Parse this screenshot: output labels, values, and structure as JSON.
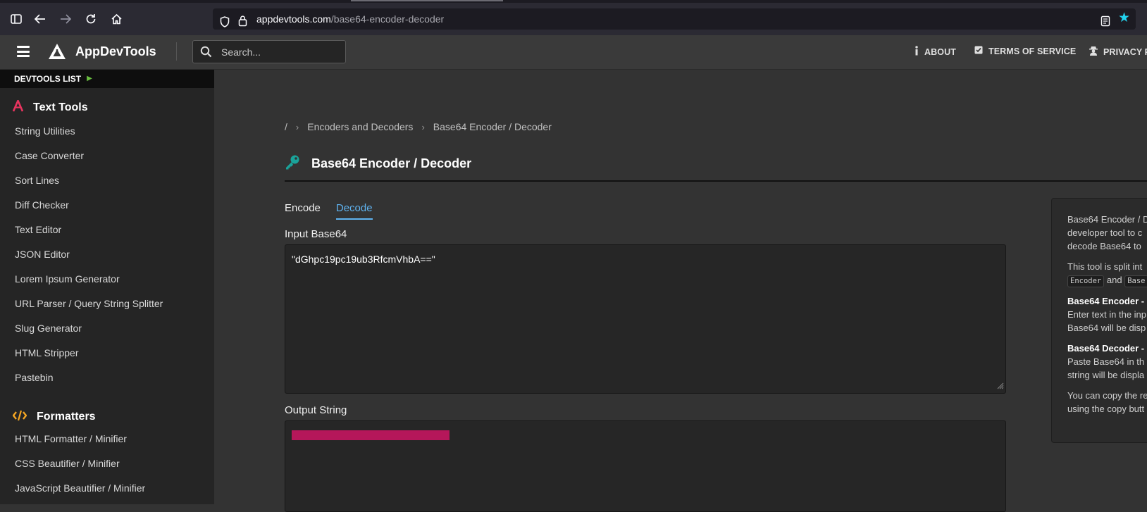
{
  "browser": {
    "url_host": "appdevtools.com",
    "url_path": "/base64-encoder-decoder"
  },
  "header": {
    "brand": "AppDevTools",
    "search_placeholder": "Search...",
    "links": {
      "about": "ABOUT",
      "terms": "TERMS OF SERVICE",
      "privacy": "PRIVACY P"
    }
  },
  "sidebar": {
    "list_label": "DEVTOOLS LIST",
    "sections": [
      {
        "title": "Text Tools",
        "icon": "text-a-icon",
        "items": [
          "String Utilities",
          "Case Converter",
          "Sort Lines",
          "Diff Checker",
          "Text Editor",
          "JSON Editor",
          "Lorem Ipsum Generator",
          "URL Parser / Query String Splitter",
          "Slug Generator",
          "HTML Stripper",
          "Pastebin"
        ]
      },
      {
        "title": "Formatters",
        "icon": "code-icon",
        "items": [
          "HTML Formatter / Minifier",
          "CSS Beautifier / Minifier",
          "JavaScript Beautifier / Minifier"
        ]
      }
    ]
  },
  "main": {
    "breadcrumb": {
      "root": "/",
      "category": "Encoders and Decoders",
      "current": "Base64 Encoder / Decoder"
    },
    "title": "Base64 Encoder / Decoder",
    "tabs": {
      "encode": "Encode",
      "decode": "Decode",
      "active": "decode"
    },
    "input_label": "Input Base64",
    "input_value": "\"dGhpc19pc19ub3RfcmVhbA==\"",
    "output_label": "Output String"
  },
  "info": {
    "p1": [
      "Base64 Encoder / D",
      "developer tool to c",
      "decode Base64 to"
    ],
    "p2_line1": "This tool is split int",
    "p2_chip1": "Encoder",
    "p2_and": "and",
    "p2_chip2": "Base",
    "encoder_title": "Base64 Encoder -",
    "encoder_lines": [
      "Enter text in the inp",
      "Base64 will be disp"
    ],
    "decoder_title": "Base64 Decoder -",
    "decoder_lines": [
      "Paste Base64 in th",
      "string will be displa"
    ],
    "copy_lines": [
      "You can copy the re",
      "using the copy butt"
    ]
  },
  "colors": {
    "accent_blue": "#5fb3f0",
    "text_tools_icon": "#e8345f",
    "formatters_icon": "#f5a623",
    "key_icon": "#1aa39a",
    "redaction": "#b5175a",
    "star": "#22d3ee"
  }
}
